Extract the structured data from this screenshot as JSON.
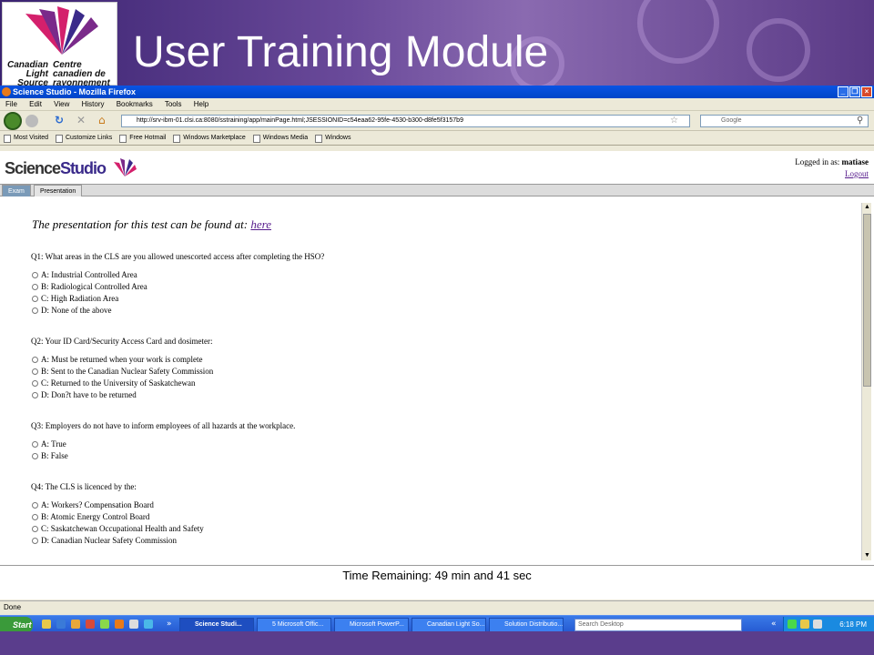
{
  "banner": {
    "title": "User Training Module",
    "logo_en": "Canadian Light Source",
    "logo_fr": "Centre canadien de rayonnement synchrotron"
  },
  "browser": {
    "window_title": "Science Studio - Mozilla Firefox",
    "menu": [
      "File",
      "Edit",
      "View",
      "History",
      "Bookmarks",
      "Tools",
      "Help"
    ],
    "url": "http://srv-ibm-01.clsi.ca:8080/sstraining/app/mainPage.html;JSESSIONID=c54eaa62-95fe-4530-b300-d8fe5f3157b9",
    "search_placeholder": "Google",
    "bookmarks": [
      "Most Visited",
      "Customize Links",
      "Free Hotmail",
      "Windows Marketplace",
      "Windows Media",
      "Windows"
    ],
    "status": "Done"
  },
  "app": {
    "logo_a": "Science",
    "logo_b": "Studio",
    "logged_in_label": "Logged in as: ",
    "username": "matiase",
    "logout_label": "Logout",
    "tabs": [
      "Exam",
      "Presentation"
    ]
  },
  "exam": {
    "intro": "The presentation for this test can be found at: ",
    "intro_link": "here",
    "questions": [
      {
        "text": "Q1: What areas in the CLS are you allowed unescorted access after completing the HSO?",
        "options": [
          "A: Industrial Controlled Area",
          "B: Radiological Controlled Area",
          "C: High Radiation Area",
          "D: None of the above"
        ]
      },
      {
        "text": "Q2: Your ID Card/Security Access Card and dosimeter:",
        "options": [
          "A: Must be returned when your work is complete",
          "B: Sent to the Canadian Nuclear Safety Commission",
          "C: Returned to the University of Saskatchewan",
          "D: Don?t have to be returned"
        ]
      },
      {
        "text": "Q3: Employers do not have to inform employees of all hazards at the workplace.",
        "options": [
          "A: True",
          "B: False"
        ]
      },
      {
        "text": "Q4: The CLS is licenced by the:",
        "options": [
          "A: Workers? Compensation Board",
          "B: Atomic Energy Control Board",
          "C: Saskatchewan Occupational Health and Safety",
          "D: Canadian Nuclear Safety Commission"
        ]
      }
    ],
    "timer": "Time Remaining: 49 min and 41 sec"
  },
  "taskbar": {
    "start": "Start",
    "buttons": [
      "Science Studi...",
      "5 Microsoft Offic...",
      "Microsoft PowerP...",
      "Canadian Light So...",
      "Solution Distributio..."
    ],
    "search_placeholder": "Search Desktop",
    "clock": "6:18 PM"
  }
}
